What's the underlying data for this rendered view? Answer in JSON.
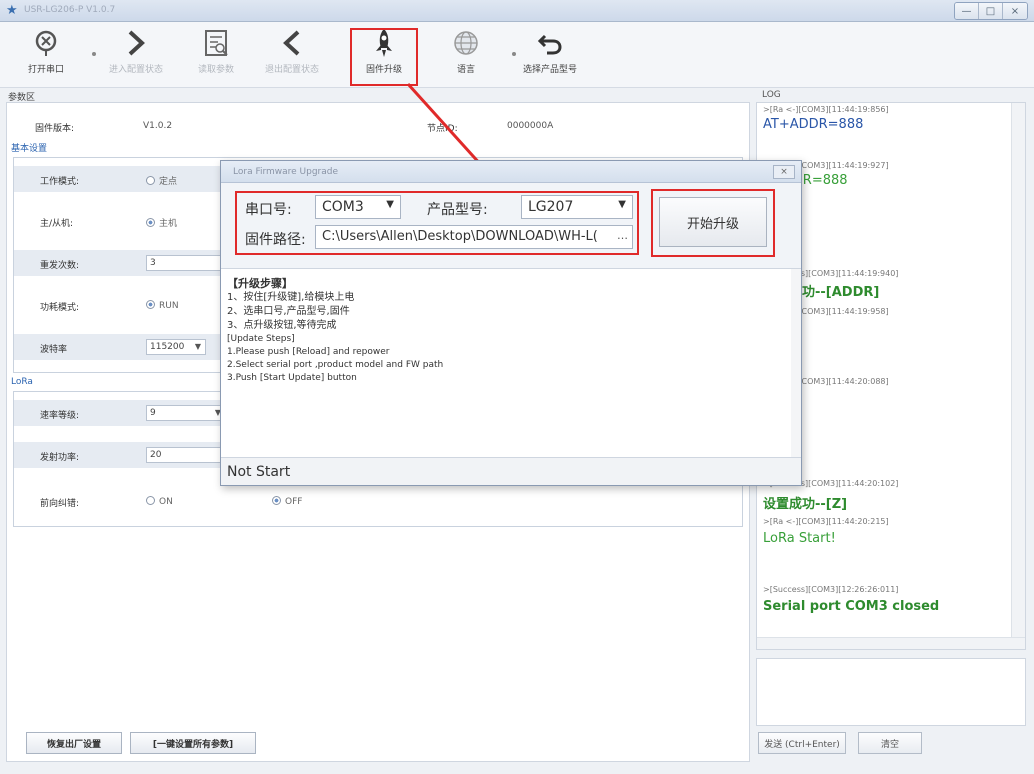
{
  "window": {
    "title": "USR-LG206-P V1.0.7",
    "minimize_glyph": "—",
    "maximize_glyph": "□",
    "close_glyph": "×"
  },
  "toolbar": {
    "items": [
      {
        "label": "打开串口",
        "icon": "serial-port-icon",
        "enabled": true
      },
      {
        "label": "进入配置状态",
        "icon": "chevron-right-icon",
        "enabled": false
      },
      {
        "label": "读取参数",
        "icon": "read-params-icon",
        "enabled": false
      },
      {
        "label": "退出配置状态",
        "icon": "chevron-left-icon",
        "enabled": false
      },
      {
        "label": "固件升级",
        "icon": "rocket-icon",
        "enabled": true,
        "highlighted": true
      },
      {
        "label": "语言",
        "icon": "globe-icon",
        "enabled": true
      },
      {
        "label": "选择产品型号",
        "icon": "undo-arrow-icon",
        "enabled": true
      }
    ]
  },
  "params": {
    "area_label": "参数区",
    "firmware_version_label": "固件版本:",
    "firmware_version_value": "V1.0.2",
    "node_id_label": "节点ID:",
    "node_id_value": "0000000A",
    "basic_section": "基本设置",
    "work_mode_label": "工作模式:",
    "work_mode_value": "定点",
    "master_slave_label": "主/从机:",
    "master_slave_value": "主机",
    "retry_label": "重发次数:",
    "retry_value": "3",
    "func_mode_label": "功耗模式:",
    "func_mode_value": "RUN",
    "baud_label": "波特率",
    "baud_value": "115200",
    "lora_section": "LoRa",
    "speed_label": "速率等级:",
    "speed_value": "9",
    "power_label": "发射功率:",
    "power_value": "20",
    "fec_label": "前向纠错:",
    "fec_on": "ON",
    "fec_off": "OFF",
    "restore_btn": "恢复出厂设置",
    "one_key_btn": "[一键设置所有参数]"
  },
  "log": {
    "label": "LOG",
    "lines": [
      {
        "type": "meta",
        "text": ">[Ra <-][COM3][11:44:19:856]"
      },
      {
        "type": "big",
        "text": "AT+ADDR=888",
        "color": "#2a56a8"
      },
      {
        "type": "meta",
        "text": ">[Ra <-][COM3][11:44:19:927]"
      },
      {
        "type": "big",
        "text": "+ADDR=888",
        "color": "#39a03a"
      },
      {
        "type": "meta",
        "text": ">[Success][COM3][11:44:19:940]"
      },
      {
        "type": "bigbold",
        "text": "设置成功--[ADDR]",
        "color": "#2e8b2e"
      },
      {
        "type": "meta",
        "text": ">[Ra <-][COM3][11:44:19:958]"
      },
      {
        "type": "meta",
        "text": ">[Ra <-][COM3][11:44:20:088]"
      },
      {
        "type": "meta",
        "text": ">[Success][COM3][11:44:20:102]"
      },
      {
        "type": "bigbold",
        "text": "设置成功--[Z]",
        "color": "#2e8b2e"
      },
      {
        "type": "meta",
        "text": ">[Ra <-][COM3][11:44:20:215]"
      },
      {
        "type": "big",
        "text": "LoRa Start!",
        "color": "#39a03a"
      },
      {
        "type": "meta",
        "text": ">[Success][COM3][12:26:26:011]"
      },
      {
        "type": "bigbold",
        "text": "Serial port COM3 closed",
        "color": "#2e8b2e"
      }
    ],
    "send_btn": "发送 (Ctrl+Enter)",
    "clear_btn": "清空"
  },
  "dialog": {
    "title": "Lora Firmware Upgrade",
    "close": "×",
    "port_label": "串口号:",
    "port_value": "COM3",
    "model_label": "产品型号:",
    "model_value": "LG207",
    "path_label": "固件路径:",
    "path_value": "C:\\Users\\Allen\\Desktop\\DOWNLOAD\\WH-L(",
    "path_browse": "…",
    "start_btn": "开始升级",
    "steps": [
      "【升级步骤】",
      "1、按住[升级键],给模块上电",
      "2、选串口号,产品型号,固件",
      "3、点升级按钮,等待完成",
      "[Update Steps]",
      "1.Please push [Reload] and repower",
      "2.Select serial port ,product model and FW path",
      "3.Push [Start Update] button"
    ],
    "status": "Not Start"
  },
  "colors": {
    "highlight": "#e02a2a",
    "log_blue": "#2a56a8",
    "log_green": "#2e8b2e"
  }
}
